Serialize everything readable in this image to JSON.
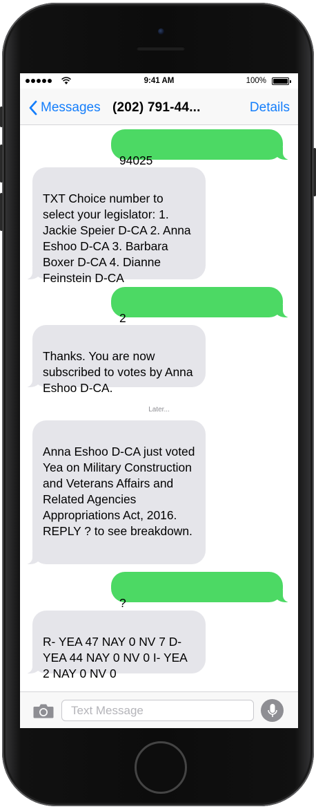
{
  "status": {
    "time": "9:41 AM",
    "battery": "100%",
    "battery_level": 1.0
  },
  "nav": {
    "back_label": "Messages",
    "title": "(202) 791-44...",
    "details_label": "Details"
  },
  "messages": [
    {
      "direction": "outgoing",
      "text": "94025"
    },
    {
      "direction": "incoming",
      "text": "TXT Choice number to select your legislator: 1. Jackie Speier D-CA 2. Anna Eshoo D-CA 3. Barbara Boxer D-CA 4. Dianne Feinstein D-CA"
    },
    {
      "direction": "outgoing",
      "text": "2"
    },
    {
      "direction": "incoming",
      "text": "Thanks. You are now subscribed to votes by Anna Eshoo D-CA."
    },
    {
      "direction": "incoming",
      "text": "Anna Eshoo D-CA just voted Yea on Military Construction and Veterans Affairs and Related Agencies Appropriations Act, 2016. REPLY ? to see breakdown."
    },
    {
      "direction": "outgoing",
      "text": "?"
    },
    {
      "direction": "incoming",
      "text": "R- YEA 47 NAY 0 NV 7 D- YEA 44 NAY 0 NV 0 I- YEA 2 NAY 0 NV 0"
    }
  ],
  "later_label": "Later...",
  "composer": {
    "placeholder": "Text Message",
    "value": ""
  },
  "colors": {
    "outgoing_bubble": "#4cd964",
    "incoming_bubble": "#e5e5ea",
    "accent": "#147efb"
  }
}
